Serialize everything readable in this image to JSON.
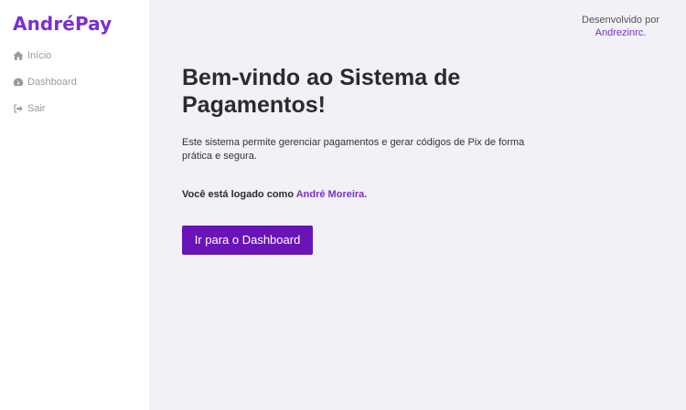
{
  "sidebar": {
    "brand": "AndréPay",
    "items": [
      {
        "label": "Início",
        "icon": "home-icon"
      },
      {
        "label": "Dashboard",
        "icon": "gauge-icon"
      },
      {
        "label": "Sair",
        "icon": "sign-out-icon"
      }
    ]
  },
  "credits": {
    "line1": "Desenvolvido por",
    "author": "Andrezinrc."
  },
  "main": {
    "title": "Bem-vindo ao Sistema de Pagamentos!",
    "description": "Este sistema permite gerenciar pagamentos e gerar códigos de Pix de forma prática e segura.",
    "logged_prefix": "Você está logado como",
    "logged_user": "André Moreira.",
    "cta_label": "Ir para o Dashboard"
  },
  "colors": {
    "accent": "#7b2fd0",
    "button": "#6a14b8",
    "background": "#f2f1f6",
    "sidebar": "#ffffff"
  }
}
